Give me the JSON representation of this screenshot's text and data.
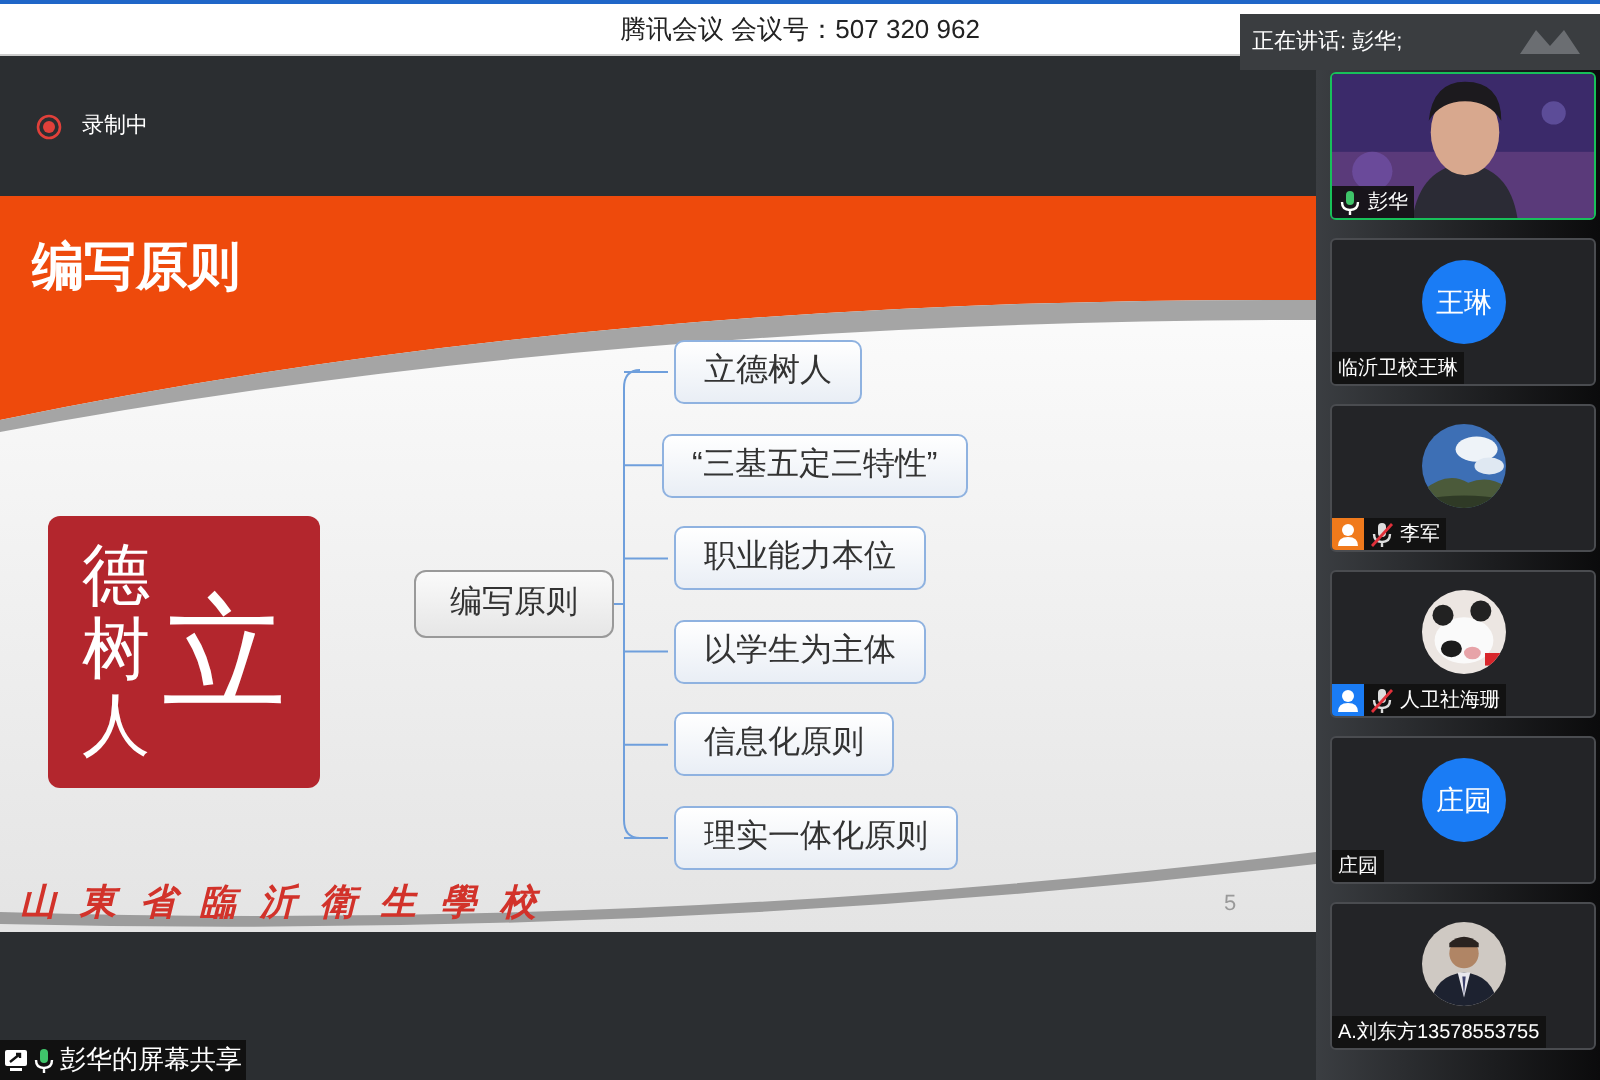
{
  "title_bar": {
    "title": "腾讯会议 会议号：507 320 962"
  },
  "speaking_banner": {
    "text": "正在讲话: 彭华;"
  },
  "recording": {
    "text": "录制中"
  },
  "slide": {
    "title": "编写原则",
    "seal": {
      "column": "德树人",
      "glyph": "立"
    },
    "mind_map": {
      "root": "编写原则",
      "children": [
        {
          "label": "立德树人"
        },
        {
          "label": "“三基五定三特性”"
        },
        {
          "label": "职业能力本位"
        },
        {
          "label": "以学生为主体"
        },
        {
          "label": "信息化原则"
        },
        {
          "label": "理实一体化原则"
        }
      ]
    },
    "footer": "山東省臨沂衛生學校",
    "page_number": "5"
  },
  "share_label": {
    "text": "彭华的屏幕共享"
  },
  "participants": [
    {
      "kind": "video",
      "name": "彭华",
      "mic": true,
      "muted": false,
      "speaking": true
    },
    {
      "kind": "initials",
      "avatar": "王琳",
      "name": "临沂卫校王琳",
      "mic": false,
      "speaking": false
    },
    {
      "name": "李军",
      "color": "#f07a1c",
      "mic": true,
      "muted": true,
      "speaking": false
    },
    {
      "name": "人卫社海珊",
      "color": "#1a7cf5",
      "mic": true,
      "muted": true,
      "speaking": false
    },
    {
      "kind": "initials",
      "avatar": "庄园",
      "name": "庄园",
      "mic": false,
      "speaking": false
    },
    {
      "name": "A.刘东方13578553755",
      "mic": false,
      "speaking": false
    }
  ]
}
